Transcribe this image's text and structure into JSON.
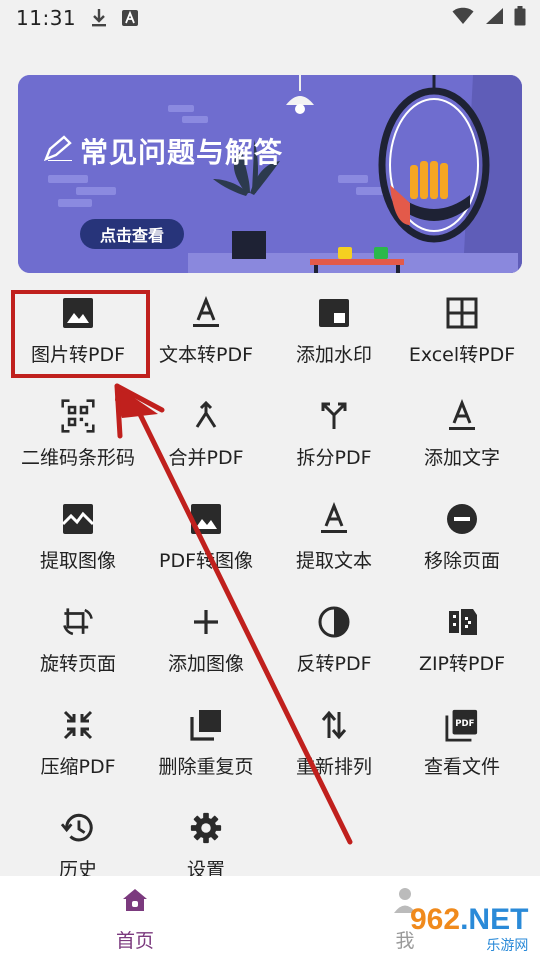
{
  "status": {
    "time": "11:31",
    "icons": [
      "download-icon",
      "notification-a-icon",
      "wifi-icon",
      "signal-icon",
      "battery-icon"
    ]
  },
  "banner": {
    "title": "常见问题与解答",
    "button": "点击查看"
  },
  "tools": [
    {
      "label": "图片转PDF",
      "icon": "image-icon"
    },
    {
      "label": "文本转PDF",
      "icon": "text-a-icon"
    },
    {
      "label": "添加水印",
      "icon": "watermark-icon"
    },
    {
      "label": "Excel转PDF",
      "icon": "grid-icon"
    },
    {
      "label": "二维码条形码",
      "icon": "qr-code-icon"
    },
    {
      "label": "合并PDF",
      "icon": "merge-icon"
    },
    {
      "label": "拆分PDF",
      "icon": "split-icon"
    },
    {
      "label": "添加文字",
      "icon": "text-a-icon"
    },
    {
      "label": "提取图像",
      "icon": "image-extract-icon"
    },
    {
      "label": "PDF转图像",
      "icon": "image-icon"
    },
    {
      "label": "提取文本",
      "icon": "text-a-icon"
    },
    {
      "label": "移除页面",
      "icon": "remove-circle-icon"
    },
    {
      "label": "旋转页面",
      "icon": "rotate-icon"
    },
    {
      "label": "添加图像",
      "icon": "plus-icon"
    },
    {
      "label": "反转PDF",
      "icon": "invert-icon"
    },
    {
      "label": "ZIP转PDF",
      "icon": "zip-icon"
    },
    {
      "label": "压缩PDF",
      "icon": "compress-icon"
    },
    {
      "label": "删除重复页",
      "icon": "duplicate-icon"
    },
    {
      "label": "重新排列",
      "icon": "reorder-icon"
    },
    {
      "label": "查看文件",
      "icon": "pdf-file-icon"
    },
    {
      "label": "历史",
      "icon": "history-icon"
    },
    {
      "label": "设置",
      "icon": "gear-icon"
    }
  ],
  "nav": {
    "home": "首页",
    "me": "我"
  },
  "watermark": {
    "num_orange": "962",
    "num_blue": ".NET",
    "sub": "乐游网"
  },
  "colors": {
    "accent": "#7b3a7e",
    "highlight": "#c0201d",
    "banner": "#6f6dcf"
  }
}
